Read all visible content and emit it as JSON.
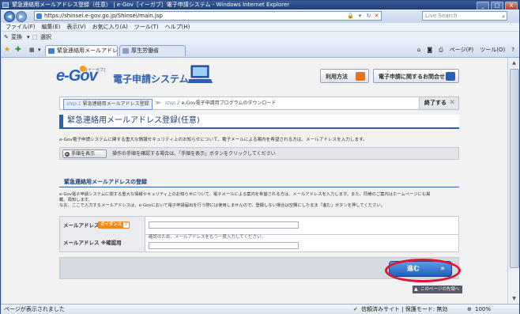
{
  "window": {
    "title": "緊急連絡用メールアドレス登録（任意） | e-Gov［イーガブ］電子申請システム - Windows Internet Explorer",
    "min_label": "_",
    "max_label": "□",
    "close_label": "X"
  },
  "addressbar": {
    "url": "https://shinsei.e-gov.go.jp/Shinsei/main.jsp",
    "search_placeholder": "Live Search",
    "back_glyph": "◀",
    "forward_glyph": "▶"
  },
  "menu": [
    "ファイル(F)",
    "編集(E)",
    "表示(V)",
    "お気に入り(A)",
    "ツール(T)",
    "ヘルプ(H)"
  ],
  "toolbar2": {
    "convert_label": "変換",
    "select_label": "選択"
  },
  "tabs": [
    {
      "label": "緊急連絡用メールアドレ..."
    },
    {
      "label": "厚生労働省"
    }
  ],
  "commandbar": {
    "page_label": "ページ(P)",
    "tools_label": "ツール(O)"
  },
  "header": {
    "logo": "e-Gov",
    "logo_small": "[イーガブ]",
    "system_name": "電子申請システム",
    "usage_button": "利用方法",
    "inquiry_button": "電子申請に関するお問合せ"
  },
  "steps": {
    "step1_num": "step.1",
    "step1_label": "緊急連絡用メールアドレス登録",
    "step2_num": "step.2",
    "step2_label": "e-Gov電子申請用プログラムのダウンロード",
    "end_label": "終了する"
  },
  "page_title": "緊急連絡用メールアドレス登録(任意)",
  "intro_text": "e-Gov電子申請システムに関する重大な情報セキュリティ上のお知らせについて、電子メールによる案内を希望される方は、メールアドレスを入力します。",
  "procedure": {
    "button_label": "手順を表示",
    "text": "操作の手順を確認する場合は、「手順を表示」ボタンをクリックしてください"
  },
  "section_title": "緊急連絡用メールアドレスの登録",
  "section_desc": [
    "e-Gov電子申請システムに関する重大な情報セキュリティ上のお知らせについて、電子メールによる案内を希望される方は、メールアドレスを入力します。また、同様のご案内はホームページにも掲",
    "載、周知します。",
    "なお、ここで入力するメールアドレスは、e-Govにおいて電子申請届出を行う際には使用しませんので、登録しない場合は空欄にしたまま「進む」ボタンを押してください。"
  ],
  "form": {
    "email_label": "メールアドレス",
    "guidance_label": "ガイダンス",
    "confirm_label": "メールアドレス ※確認用",
    "confirm_hint": "確認のため、メールアドレスをもう一度入力してください。"
  },
  "next_button": "進む",
  "page_top": "このページの先頭へ",
  "status": {
    "left": "ページが表示されました",
    "zone": "信頼済みサイト | 保護モード: 無効",
    "zoom": "100%"
  }
}
